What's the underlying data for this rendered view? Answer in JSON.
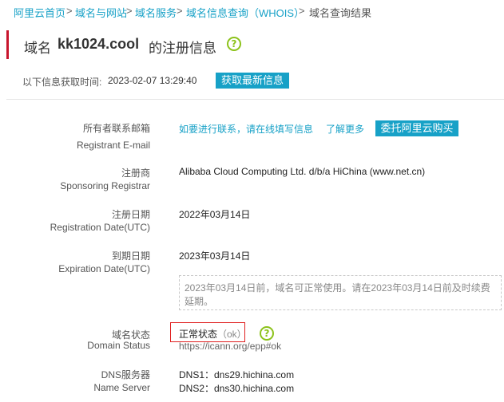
{
  "breadcrumb": {
    "items": [
      "阿里云首页",
      "域名与网站",
      "域名服务",
      "域名信息查询（WHOIS）"
    ],
    "separator": ">",
    "current": "域名查询结果"
  },
  "title": {
    "prefix": "域名",
    "domain": "kk1024.cool",
    "suffix": "的注册信息",
    "help_symbol": "?"
  },
  "fetch": {
    "label": "以下信息获取时间:",
    "time": "2023-02-07 13:29:40",
    "button": "获取最新信息"
  },
  "rows": {
    "email": {
      "label_cn": "所有者联系邮箱",
      "label_en": "Registrant E-mail",
      "contact_link": "如要进行联系，请在线填写信息",
      "more_link": "了解更多",
      "buy_button": "委托阿里云购买"
    },
    "registrar": {
      "label_cn": "注册商",
      "label_en": "Sponsoring Registrar",
      "value": "Alibaba Cloud Computing Ltd. d/b/a HiChina (www.net.cn)"
    },
    "reg_date": {
      "label_cn": "注册日期",
      "label_en": "Registration Date(UTC)",
      "value": "2022年03月14日"
    },
    "exp_date": {
      "label_cn": "到期日期",
      "label_en": "Expiration Date(UTC)",
      "value": "2023年03月14日",
      "note_line1": "2023年03月14日前，域名可正常使用。请在2023年03月14日前及时续费",
      "note_line2": "延期。"
    },
    "status": {
      "label_cn": "域名状态",
      "label_en": "Domain Status",
      "value": "正常状态",
      "code": "（ok）",
      "link": "https://icann.org/epp#ok"
    },
    "dns": {
      "label_cn": "DNS服务器",
      "label_en": "Name Server",
      "dns1": "DNS1：dns29.hichina.com",
      "dns2": "DNS2：dns30.hichina.com"
    }
  },
  "colors": {
    "accent": "#17a1c7",
    "title_marker": "#c8152d",
    "help_icon": "#8cc21a",
    "status_highlight": "#e02020"
  }
}
